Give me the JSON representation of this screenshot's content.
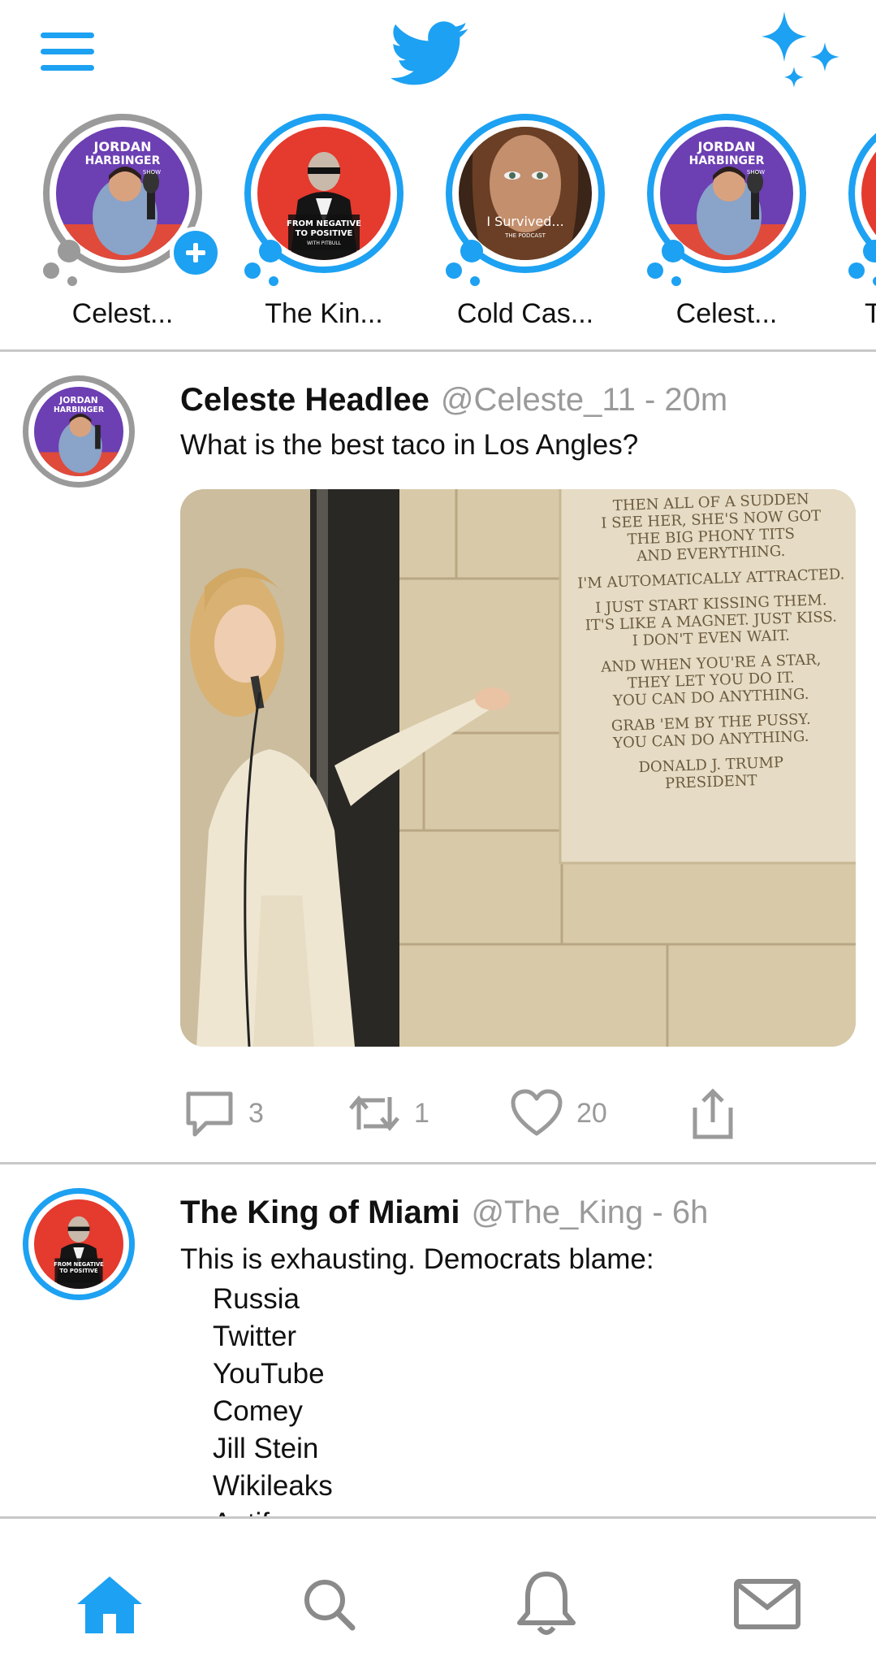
{
  "app": {
    "name": "Twitter",
    "accent_color": "#1da1f2",
    "muted_color": "#9a9a9a"
  },
  "topbar": {
    "menu_icon": "hamburger-menu-icon",
    "logo_icon": "twitter-bird-icon",
    "right_icon": "sparkle-icon"
  },
  "stories": [
    {
      "label": "Celest...",
      "ring": "grey",
      "has_add": true,
      "art": "jordan-harbinger-show"
    },
    {
      "label": "The Kin...",
      "ring": "blue",
      "has_add": false,
      "art": "from-negative-to-positive"
    },
    {
      "label": "Cold Cas...",
      "ring": "blue",
      "has_add": false,
      "art": "i-survived"
    },
    {
      "label": "Celest...",
      "ring": "blue",
      "has_add": false,
      "art": "jordan-harbinger-show"
    },
    {
      "label": "T",
      "ring": "blue",
      "has_add": false,
      "art": "partial"
    }
  ],
  "story_art": {
    "jordan": {
      "line1": "JORDAN",
      "line2": "HARBINGER",
      "line3": "SHOW"
    },
    "negative": {
      "line1": "FROM NEGATIVE",
      "line2": "TO POSITIVE",
      "line3": "WITH PITBULL"
    },
    "survived": {
      "line1": "I Survived...",
      "line2": "THE PODCAST"
    }
  },
  "tweets": [
    {
      "name": "Celeste Headlee",
      "handle": "@Celeste_11 - 20m",
      "text": "What is the best taco in Los Angles?",
      "image": {
        "plaque_lines": [
          "THEN ALL OF A SUDDEN",
          "I SEE HER, SHE'S NOW GOT",
          "THE BIG PHONY TITS",
          "AND EVERYTHING.",
          "",
          "I'M AUTOMATICALLY ATTRACTED.",
          "",
          "I JUST START KISSING THEM.",
          "IT'S LIKE A MAGNET. JUST KISS.",
          "I DON'T EVEN WAIT.",
          "",
          "AND WHEN YOU'RE A STAR,",
          "THEY LET YOU DO IT.",
          "YOU CAN DO ANYTHING.",
          "",
          "GRAB 'EM BY THE PUSSY.",
          "YOU CAN DO ANYTHING.",
          "",
          "DONALD J. TRUMP",
          "PRESIDENT"
        ]
      },
      "actions": {
        "replies": "3",
        "retweets": "1",
        "likes": "20"
      }
    },
    {
      "name": "The King of Miami",
      "handle": "@The_King - 6h",
      "text": "This is exhausting. Democrats blame:",
      "list": [
        "Russia",
        "Twitter",
        "YouTube",
        "Comey",
        "Jill Stein",
        "Wikileaks",
        "Antifa"
      ]
    }
  ],
  "bottom_nav": [
    {
      "icon": "home-icon",
      "active": true
    },
    {
      "icon": "search-icon",
      "active": false
    },
    {
      "icon": "bell-icon",
      "active": false
    },
    {
      "icon": "mail-icon",
      "active": false
    }
  ]
}
